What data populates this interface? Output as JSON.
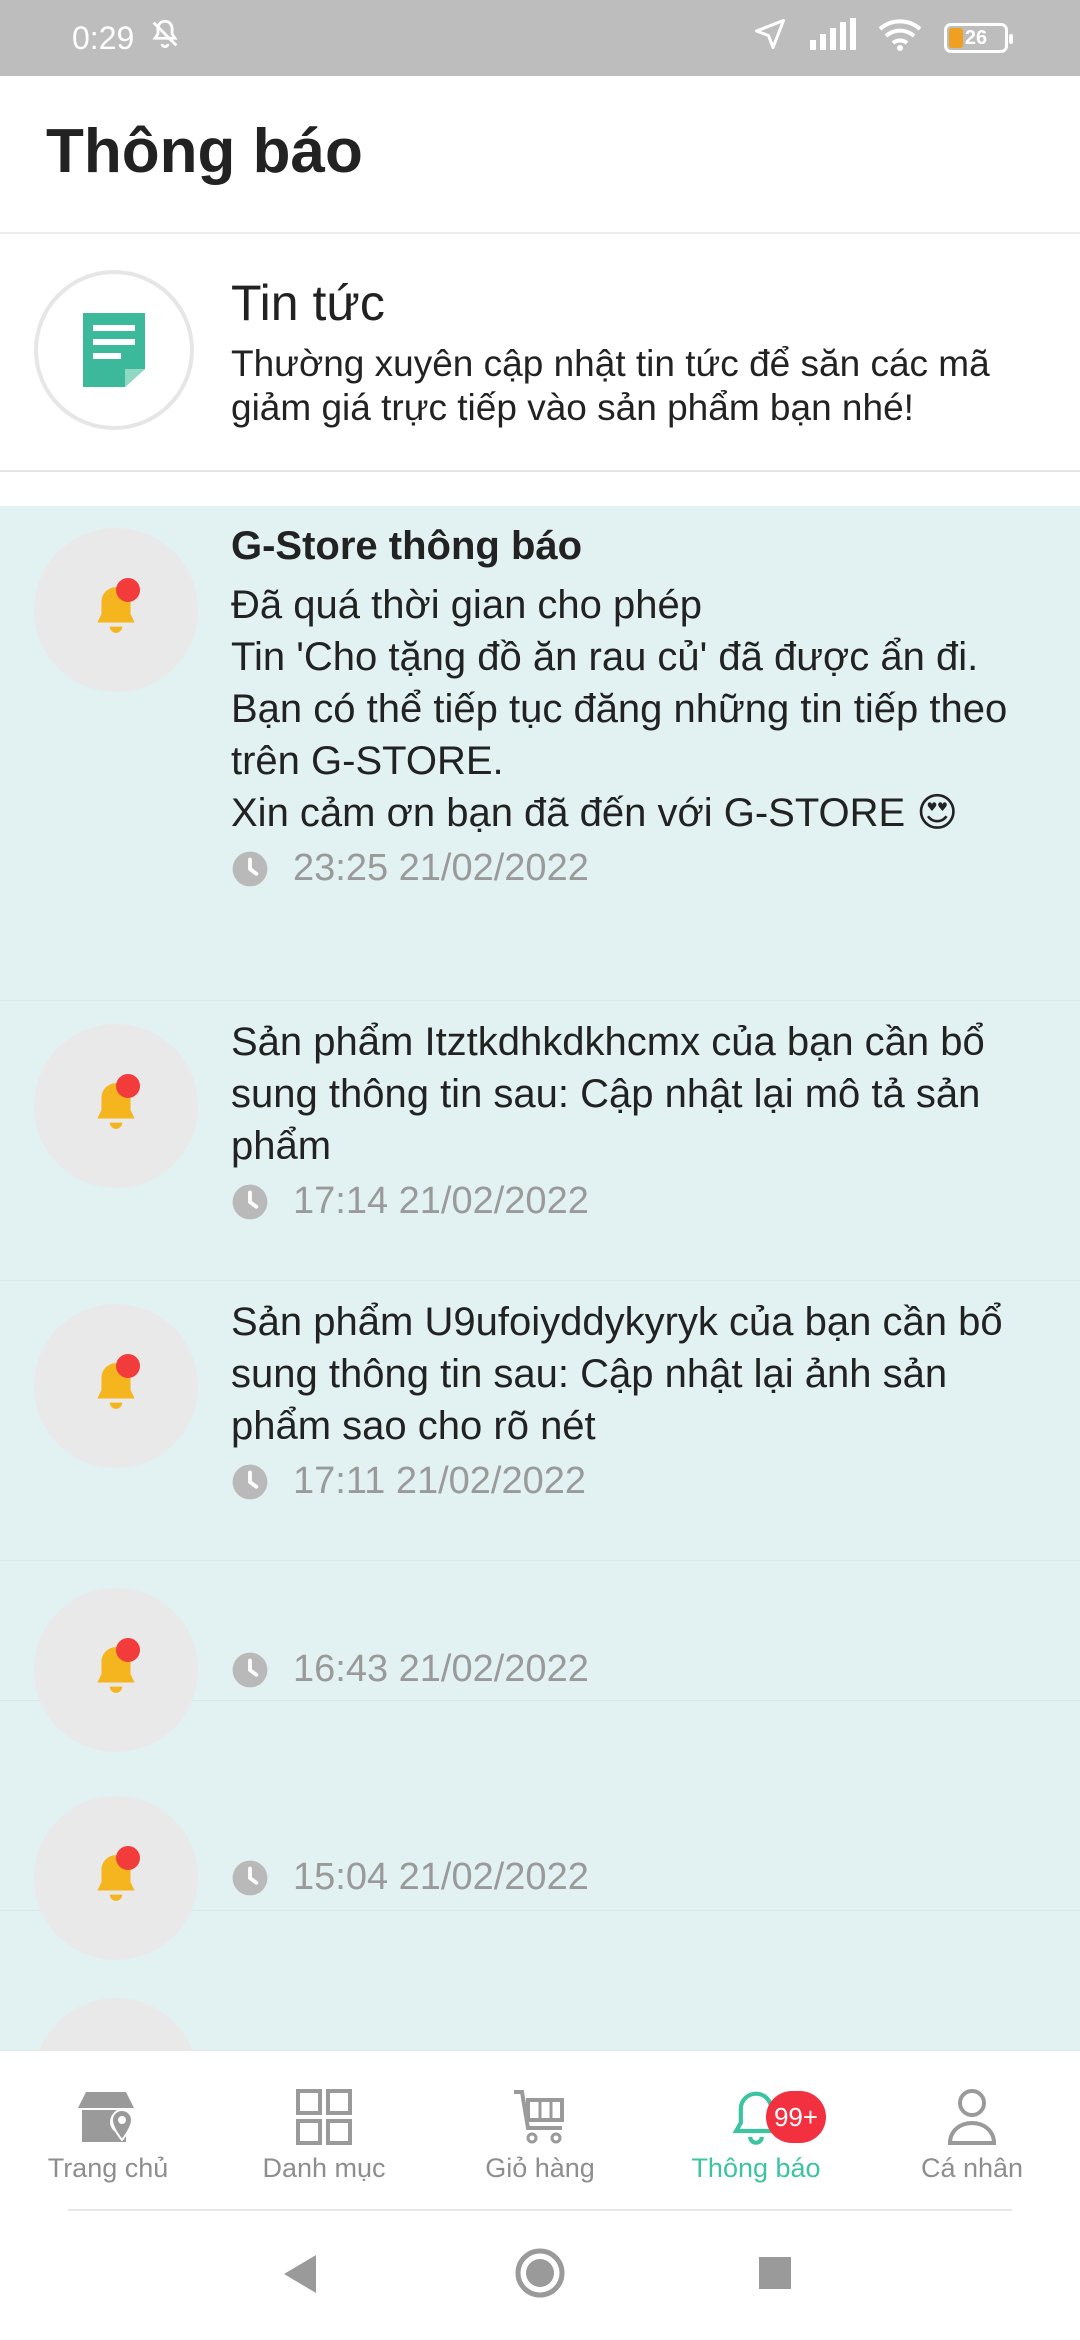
{
  "status_bar": {
    "time": "0:29",
    "battery": "26"
  },
  "header": {
    "title": "Thông báo"
  },
  "news": {
    "title": "Tin tức",
    "description": "Thường xuyên cập nhật tin tức để săn các mã giảm giá trực tiếp vào sản phẩm bạn nhé!"
  },
  "notifications": [
    {
      "title": "G-Store thông báo",
      "lines": [
        "Đã quá thời gian cho phép",
        "Tin 'Cho tặng đồ ăn rau củ' đã được ẩn đi.",
        "Bạn có thể tiếp tục đăng những tin tiếp theo trên G-STORE.",
        "Xin cảm ơn bạn đã đến với G-STORE 😍"
      ],
      "time": "23:25 21/02/2022"
    },
    {
      "text": "Sản phẩm Itztkdhkdkhcmx của bạn cần bổ sung thông tin sau: Cập nhật lại mô tả sản phẩm",
      "time": "17:14 21/02/2022"
    },
    {
      "text": "Sản phẩm U9ufoiyddykyryk của bạn cần bổ sung thông tin sau: Cập nhật lại ảnh sản phẩm sao cho rõ nét",
      "time": "17:11 21/02/2022"
    },
    {
      "time": "16:43 21/02/2022"
    },
    {
      "time": "15:04 21/02/2022"
    }
  ],
  "bottom_nav": {
    "items": [
      {
        "label": "Trang chủ",
        "icon": "store-icon"
      },
      {
        "label": "Danh mục",
        "icon": "grid-icon"
      },
      {
        "label": "Giỏ hàng",
        "icon": "cart-icon"
      },
      {
        "label": "Thông báo",
        "icon": "bell-icon",
        "badge": "99+",
        "active": true
      },
      {
        "label": "Cá nhân",
        "icon": "person-icon"
      }
    ]
  },
  "colors": {
    "accent": "#3cc4a0",
    "list_bg": "#e2f1f1",
    "badge": "#f23040",
    "bell": "#f5b51e"
  }
}
